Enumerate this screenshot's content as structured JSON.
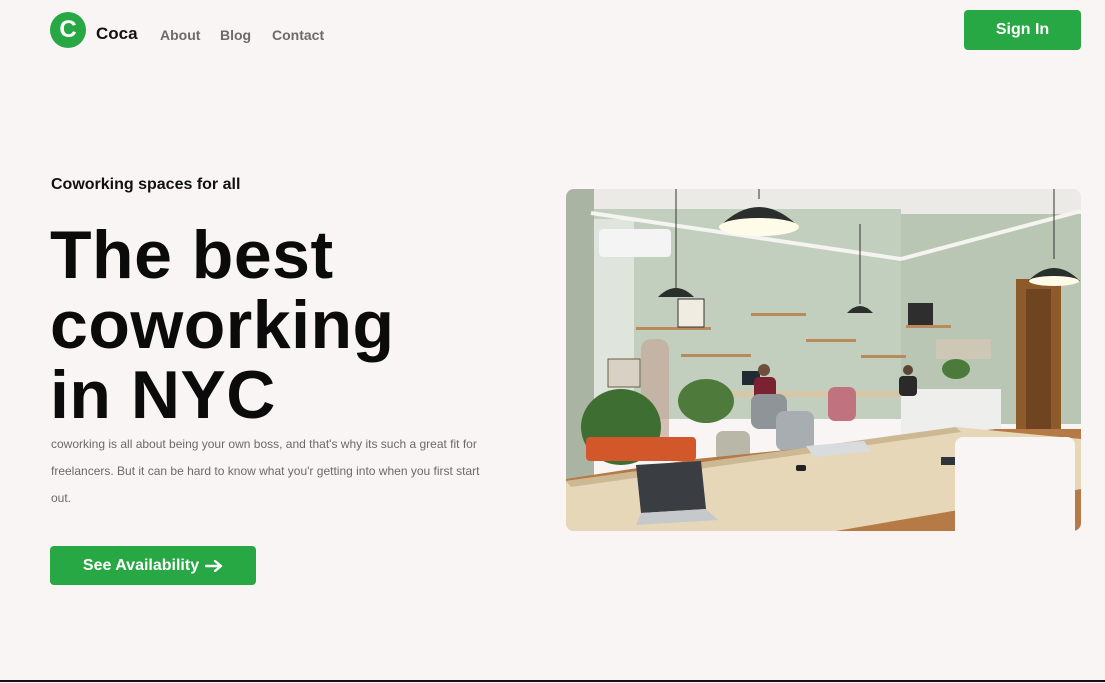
{
  "nav": {
    "brand": "Coca",
    "logo_letter": "C",
    "links": [
      "About",
      "Blog",
      "Contact"
    ],
    "signin_label": "Sign In"
  },
  "hero": {
    "eyebrow": "Coworking spaces for all",
    "headline_lines": [
      "The best",
      "coworking",
      "in NYC"
    ],
    "description": "coworking is all about being your own boss, and that's why its such a great fit for freelancers. But it can be hard to know what you'r getting into when you first start out.",
    "cta_label": "See Availability",
    "cta_icon": "arrow-right-icon",
    "image_icon": "office-photo"
  },
  "colors": {
    "accent": "#28a745",
    "background": "#f9f5f4",
    "text": "#0b0b0b",
    "muted": "#6a6a6a"
  }
}
